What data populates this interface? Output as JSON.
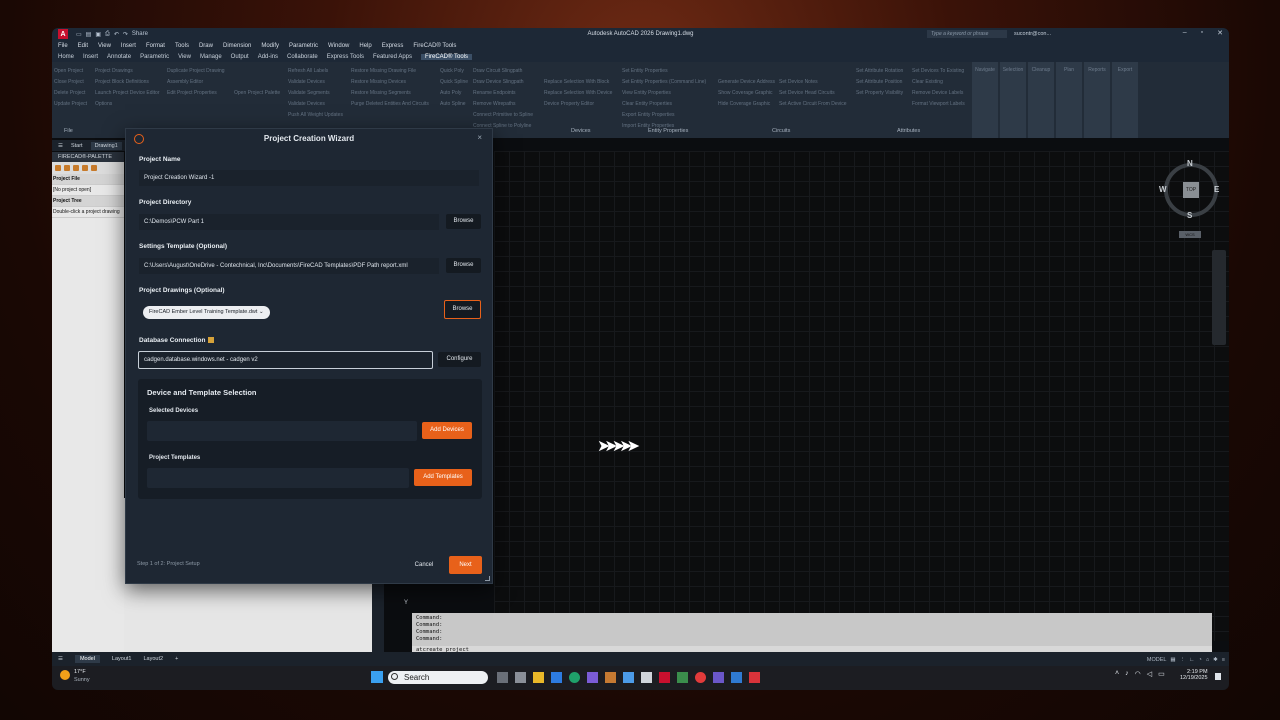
{
  "window": {
    "title": "Autodesk AutoCAD 2026   Drawing1.dwg",
    "app_logo": "A",
    "share_label": "Share",
    "search_placeholder": "Type a keyword or phrase",
    "user": "sucontr@con..."
  },
  "menubar": [
    "File",
    "Edit",
    "View",
    "Insert",
    "Format",
    "Tools",
    "Draw",
    "Dimension",
    "Modify",
    "Parametric",
    "Window",
    "Help",
    "Express",
    "FireCAD® Tools"
  ],
  "ribbon_tabs": [
    "Home",
    "Insert",
    "Annotate",
    "Parametric",
    "View",
    "Manage",
    "Output",
    "Add-ins",
    "Collaborate",
    "Express Tools",
    "Featured Apps",
    "FireCAD® Tools"
  ],
  "ribbon_active": "FireCAD® Tools",
  "ribbon_groups": {
    "g1": [
      "Open Project",
      "Close Project",
      "Delete Project",
      "Update Project"
    ],
    "g2": [
      "Project Drawings",
      "Project Block Definitions",
      "Launch Project Device Editor",
      "Options"
    ],
    "g3": [
      "Duplicate Project Drawing",
      "Assembly Editor",
      "Edit Project Properties"
    ],
    "g4": [
      "Open Project Palette"
    ],
    "g5": [
      "Refresh All Labels",
      "Validate Devices",
      "Validate Segments",
      "Validate Devices",
      "Push All Weight Updates"
    ],
    "g6": [
      "Restore Missing Drawing File",
      "Restore Missing Devices",
      "Restore Missing Segments",
      "Purge Deleted Entities And Circuits"
    ],
    "g7": [
      "Quick Poly",
      "Quick Spline",
      "Auto Poly",
      "Auto Spline"
    ],
    "g8": [
      "Draw Circuit Slingpath",
      "Draw Device Slingpath",
      "Rename Endpoints",
      "Remove Wirepaths",
      "Connect Primitive to Spline",
      "Connect Spline to Polyline"
    ],
    "g9": [
      "Replace Selection With Block",
      "Replace Selection With Device",
      "Device Property Editor"
    ],
    "g10": [
      "Set Entity Properties",
      "Set Entity Properties (Command Line)",
      "View Entity Properties",
      "Clear Entity Properties",
      "Export Entity Properties",
      "Import Entity Properties"
    ],
    "g11": [
      "Generate Device Address",
      "Show Coverage Graphic",
      "Hide Coverage Graphic"
    ],
    "g12": [
      "Set Device Notes",
      "Set Device Head Circuits",
      "Set Active Circuit From Device"
    ],
    "g13": [
      "Set Attribute Rotation",
      "Set Attribute Position",
      "Set Property Visibility"
    ],
    "g14": [
      "Set Devices To Existing",
      "Clear Existing",
      "Remove Device Labels",
      "Format Viewport Labels"
    ],
    "buttons": [
      "Navigate",
      "Selection",
      "Cleanup",
      "Plan",
      "Reports",
      "Export"
    ]
  },
  "ribbon_labels": {
    "devices": "Devices",
    "entity_properties": "Entity Properties",
    "circuits": "Circuits",
    "attributes": "Attributes",
    "file": "File"
  },
  "doc_tabs": [
    "Start",
    "Drawing1"
  ],
  "palette": {
    "title": "FIRECAD®-PALETTE",
    "project_file_label": "Project File",
    "project_file_value": "[No project open]",
    "project_tree_label": "Project Tree",
    "project_tree_hint": "Double-click a project drawing"
  },
  "viewcube": {
    "top": "TOP",
    "n": "N",
    "s": "S",
    "e": "E",
    "w": "W",
    "wcs": "WCS"
  },
  "command_history": [
    "Command:",
    "Command:",
    "Command:",
    "Command:"
  ],
  "command_input": "atcreate_project",
  "y_axis": "Y",
  "layout_tabs": [
    "Model",
    "Layout1",
    "Layout2"
  ],
  "status_model": "MODEL",
  "taskbar": {
    "weather_temp": "17°F",
    "weather_desc": "Sunny",
    "search": "Search",
    "time": "2:19 PM",
    "date": "12/19/2025"
  },
  "dialog": {
    "title": "Project Creation Wizard",
    "project_name_label": "Project Name",
    "project_name_value": "Project Creation Wizard -1",
    "project_dir_label": "Project Directory",
    "project_dir_value": "C:\\Demos\\PCW Part 1",
    "browse": "Browse",
    "settings_label": "Settings Template (Optional)",
    "settings_value": "C:\\Users\\August\\OneDrive - Contechnical, Inc\\Documents\\FireCAD Templates\\PDF Path report.xml",
    "drawings_label": "Project Drawings (Optional)",
    "drawings_chip": "FireCAD Ember Level Training Template.dwt",
    "db_label": "Database Connection",
    "db_value": "cadgen.database.windows.net - cadgen v2",
    "configure": "Configure",
    "panel_title": "Device and Template Selection",
    "selected_devices_label": "Selected Devices",
    "add_devices": "Add Devices",
    "project_templates_label": "Project Templates",
    "add_templates": "Add Templates",
    "step": "Step 1 of 2: Project Setup",
    "cancel": "Cancel",
    "next": "Next"
  },
  "colors": {
    "accent": "#e8611a",
    "dialog_bg": "#1e2733",
    "ribbon_bg": "#222c38"
  }
}
